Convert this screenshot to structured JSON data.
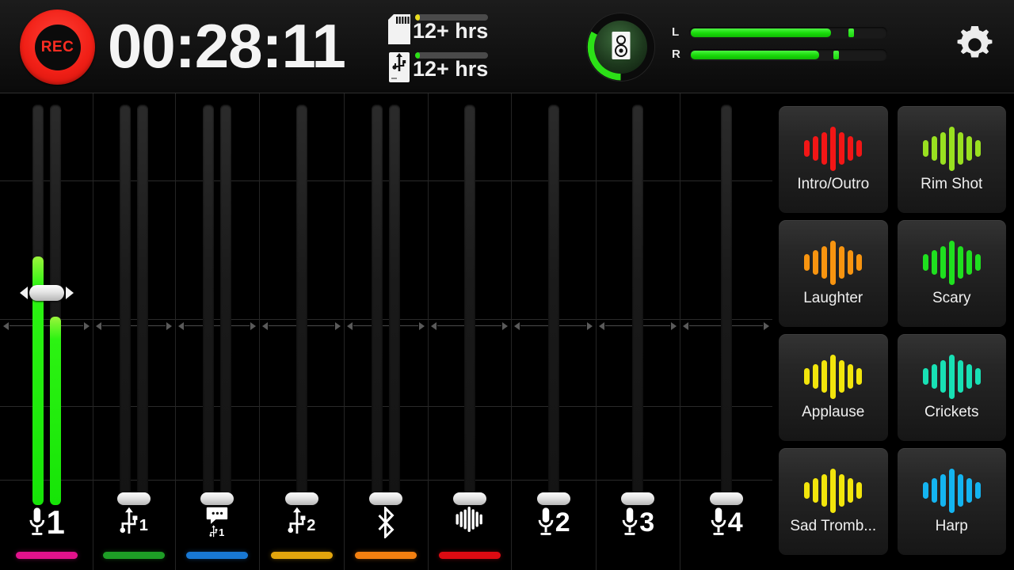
{
  "header": {
    "rec_label": "REC",
    "timer": "00:28:11",
    "storage": [
      {
        "icon": "sd-card-icon",
        "label": "12+ hrs",
        "fill_color": "#e8dc1f",
        "bar_pct": 6
      },
      {
        "icon": "usb-drive-icon",
        "label": "12+ hrs",
        "fill_color": "#2ce017",
        "bar_pct": 6
      }
    ],
    "monitor": {
      "icon": "speaker-monitor-icon",
      "arc_color": "#2ce017",
      "level_pct": 30
    },
    "meters": [
      {
        "channel": "L",
        "level_pct": 72,
        "peak_pct": 81,
        "color": "#17d908"
      },
      {
        "channel": "R",
        "level_pct": 66,
        "peak_pct": 73,
        "color": "#17d908"
      }
    ],
    "settings_icon": "gear-icon"
  },
  "mixer": {
    "channels": [
      {
        "name": "Mic 1",
        "icon": "microphone-icon",
        "number": "1",
        "color": "#e3128c",
        "fader_pct": 53,
        "active": true,
        "dual": true,
        "levels": [
          62,
          47
        ]
      },
      {
        "name": "USB 1",
        "icon": "usb-icon",
        "number": "1",
        "color": "#1e9e26",
        "fader_pct": 0,
        "active": false,
        "dual": true,
        "levels": [
          0,
          0
        ]
      },
      {
        "name": "Chat USB 1",
        "icon": "chat-bubble-icon",
        "number": "1",
        "color": "#1878d4",
        "fader_pct": 0,
        "active": false,
        "dual": true,
        "levels": [
          0,
          0
        ]
      },
      {
        "name": "USB 2",
        "icon": "usb-icon",
        "number": "2",
        "color": "#e3a50d",
        "fader_pct": 0,
        "active": false,
        "dual": false,
        "levels": [
          0
        ]
      },
      {
        "name": "Bluetooth",
        "icon": "bluetooth-icon",
        "number": "",
        "color": "#f38010",
        "fader_pct": 0,
        "active": false,
        "dual": true,
        "levels": [
          0,
          0
        ]
      },
      {
        "name": "Sound Pads",
        "icon": "waveform-icon",
        "number": "",
        "color": "#dc0b12",
        "fader_pct": 0,
        "active": false,
        "dual": false,
        "levels": [
          0
        ]
      },
      {
        "name": "Mic 2",
        "icon": "microphone-icon",
        "number": "2",
        "color": "",
        "fader_pct": 0,
        "active": false,
        "dual": false,
        "levels": [
          0
        ]
      },
      {
        "name": "Mic 3",
        "icon": "microphone-icon",
        "number": "3",
        "color": "",
        "fader_pct": 0,
        "active": false,
        "dual": false,
        "levels": [
          0
        ]
      },
      {
        "name": "Mic 4",
        "icon": "microphone-icon",
        "number": "4",
        "color": "",
        "fader_pct": 0,
        "active": false,
        "dual": false,
        "levels": [
          0
        ]
      }
    ]
  },
  "pads": [
    {
      "label": "Intro/Outro",
      "color": "#f21616",
      "icon": "waveform-icon"
    },
    {
      "label": "Rim Shot",
      "color": "#99e020",
      "icon": "waveform-icon"
    },
    {
      "label": "Laughter",
      "color": "#f79410",
      "icon": "waveform-icon"
    },
    {
      "label": "Scary",
      "color": "#1fe01f",
      "icon": "waveform-icon"
    },
    {
      "label": "Applause",
      "color": "#f2e50c",
      "icon": "waveform-icon"
    },
    {
      "label": "Crickets",
      "color": "#18e0b4",
      "icon": "waveform-icon"
    },
    {
      "label": "Sad Tromb...",
      "color": "#f2e50c",
      "icon": "waveform-icon"
    },
    {
      "label": "Harp",
      "color": "#14b4f0",
      "icon": "waveform-icon"
    }
  ]
}
